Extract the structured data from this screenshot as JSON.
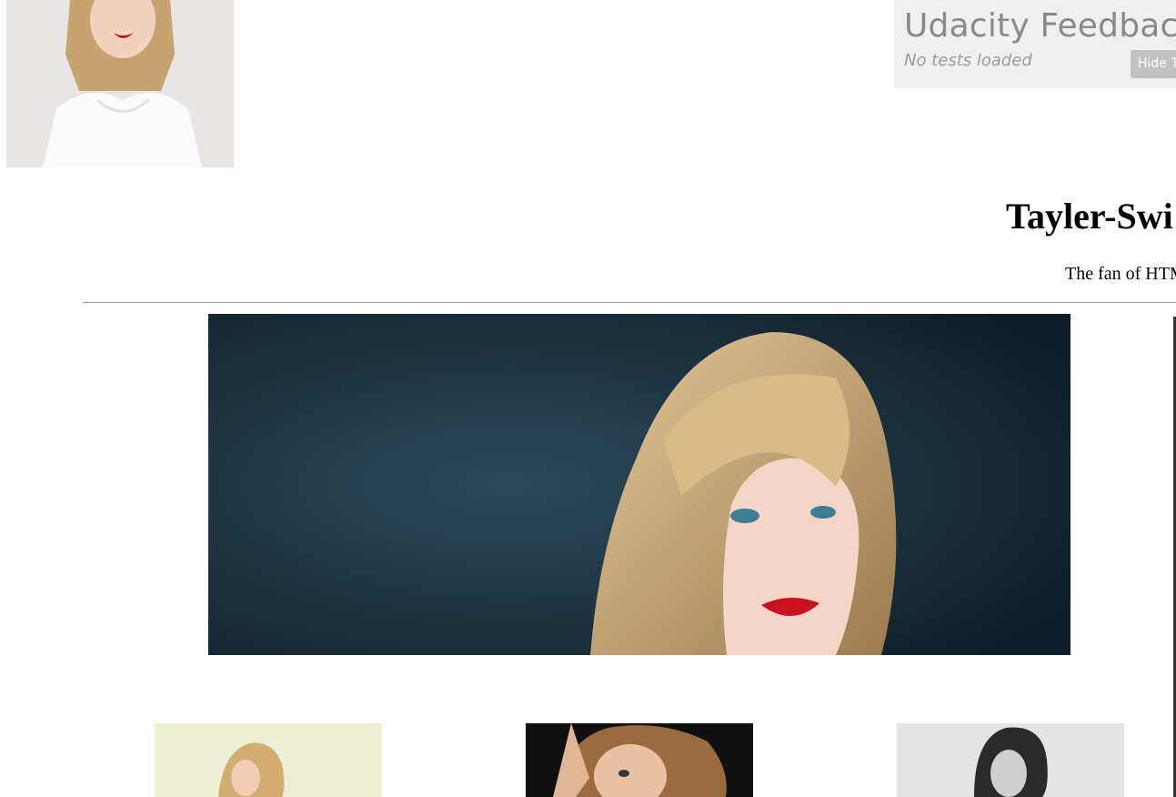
{
  "feedback_widget": {
    "title": "Udacity Feedback",
    "status": "No tests loaded",
    "hide_button_label": "Hide T"
  },
  "header": {
    "title": "Tayler-Swi",
    "tagline": "The fan of HTM"
  },
  "images": {
    "avatar": "portrait photo, white t-shirt",
    "hero": "portrait photo on dark blue background",
    "thumbnails": [
      "portrait photo, light background",
      "portrait photo, hands in hair",
      "black and white portrait photo"
    ]
  },
  "colors": {
    "widget_bg": "#f0f0f0",
    "widget_text": "#8a8a8a",
    "widget_button": "#c2c2c2",
    "divider": "#9a9a9a",
    "hero_bg": "#1f3a4a"
  }
}
